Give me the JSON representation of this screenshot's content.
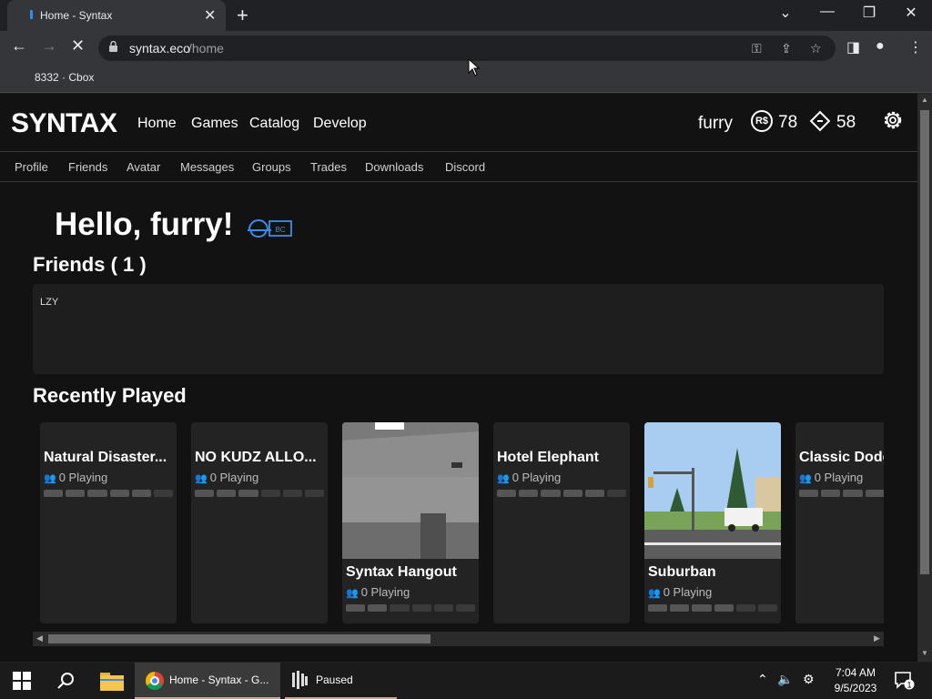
{
  "browser": {
    "tab_title": "Home - Syntax",
    "url_domain": "syntax.eco",
    "url_path": "/home",
    "bookmark": "8332 · Cbox"
  },
  "site": {
    "logo": "SYNTAX",
    "nav": [
      "Home",
      "Games",
      "Catalog",
      "Develop"
    ],
    "username": "furry",
    "robux_symbol": "R$",
    "robux": "78",
    "tix": "58",
    "subnav": [
      "Profile",
      "Friends",
      "Avatar",
      "Messages",
      "Groups",
      "Trades",
      "Downloads",
      "Discord"
    ]
  },
  "home": {
    "greeting": "Hello, furry!",
    "badge": "BC",
    "friends_title": "Friends ( 1 )",
    "friends": [
      "LZY"
    ],
    "recent_title": "Recently Played"
  },
  "games": [
    {
      "name": "Natural Disaster...",
      "playing": "0 Playing",
      "has_thumb": false
    },
    {
      "name": "NO KUDZ ALLO...",
      "playing": "0 Playing",
      "has_thumb": false
    },
    {
      "name": "Syntax Hangout",
      "playing": "0 Playing",
      "has_thumb": true
    },
    {
      "name": "Hotel Elephant",
      "playing": "0 Playing",
      "has_thumb": false
    },
    {
      "name": "Suburban",
      "playing": "0 Playing",
      "has_thumb": true
    },
    {
      "name": "Classic Dodg",
      "playing": "0 Playing",
      "has_thumb": false
    }
  ],
  "taskbar": {
    "chrome_label": "Home - Syntax - G...",
    "paused_label": "Paused",
    "time": "7:04 AM",
    "date": "9/5/2023",
    "notifications": "1"
  },
  "colors": {
    "page_bg": "#121212",
    "card_bg": "#232323",
    "accent_blue": "#3c8ce7",
    "chrome_bg": "#35363a"
  }
}
